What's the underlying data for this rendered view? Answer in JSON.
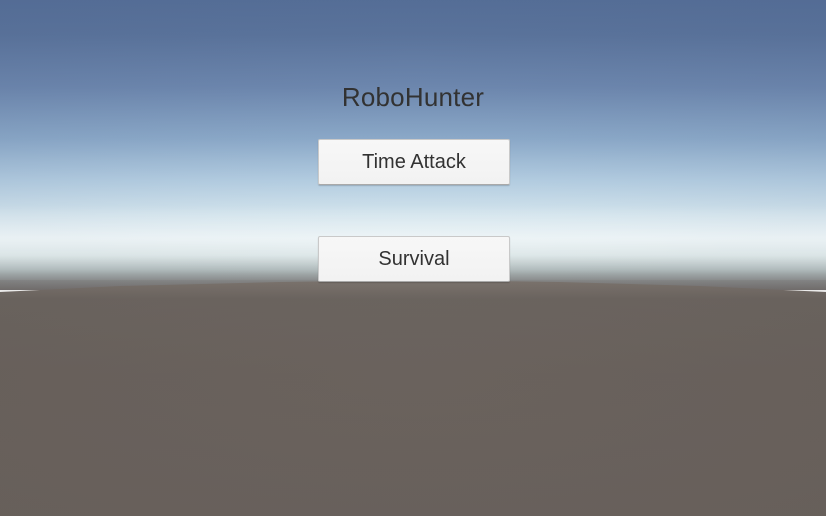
{
  "game": {
    "title": "RoboHunter"
  },
  "menu": {
    "buttons": [
      {
        "label": "Time Attack"
      },
      {
        "label": "Survival"
      }
    ]
  },
  "colors": {
    "sky_top": "#556e97",
    "horizon": "#f3fdfd",
    "ground": "#6b635e",
    "button_bg": "#f2f2f2",
    "text": "#323232"
  }
}
